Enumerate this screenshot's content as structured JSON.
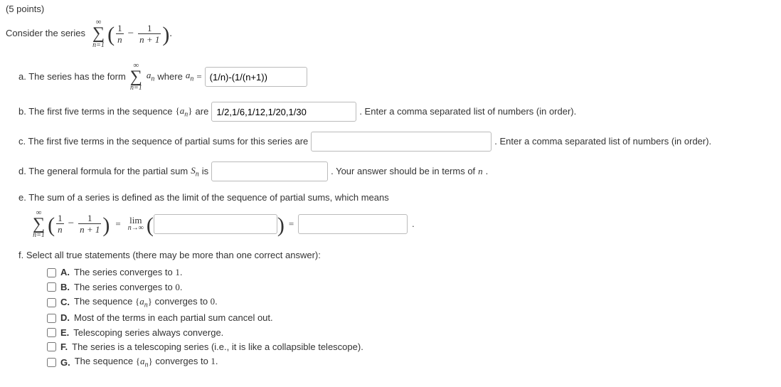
{
  "points": "(5 points)",
  "intro_label": "Consider the series",
  "sum_top": "∞",
  "sum_bottom": "n=1",
  "frac1_num": "1",
  "frac1_den": "n",
  "minus": "−",
  "frac2_num": "1",
  "frac2_den": "n + 1",
  "part_a": {
    "prefix": "a. The series has the form",
    "an_text": "aₙ",
    "where": " where ",
    "eq": " = ",
    "value": "(1/n)-(1/(n+1))"
  },
  "part_b": {
    "prefix": "b. The first five terms in the sequence ",
    "an_set": "{aₙ}",
    "are": " are ",
    "value": "1/2,1/6,1/12,1/20,1/30",
    "hint": " .  Enter a comma separated list of numbers (in order)."
  },
  "part_c": {
    "prefix": "c. The first five terms in the sequence of partial sums for this series are ",
    "value": "",
    "hint": " .  Enter a comma separated list of numbers (in order)."
  },
  "part_d": {
    "prefix": "d. The general formula for the partial sum ",
    "sn": "Sₙ",
    "is": " is ",
    "value": "",
    "hint": " .  Your answer should be in terms of ",
    "nvar": "n",
    "dot": "."
  },
  "part_e": {
    "prefix": "e. The sum of a series is defined as the limit of the sequence of partial sums, which means",
    "eq": " = ",
    "lim": "lim",
    "limsub": "n→∞",
    "val1": "",
    "val2": "",
    "dot": "."
  },
  "part_f": {
    "prefix": "f. Select all true statements (there may be more than one correct answer):",
    "choices": [
      {
        "letter": "A.",
        "text": "The series converges to ",
        "tail": "1",
        "taildot": "."
      },
      {
        "letter": "B.",
        "text": "The series converges to ",
        "tail": "0",
        "taildot": "."
      },
      {
        "letter": "C.",
        "text": "The sequence ",
        "mid": "{aₙ}",
        "text2": " converges to ",
        "tail": "0",
        "taildot": "."
      },
      {
        "letter": "D.",
        "text": "Most of the terms in each partial sum cancel out."
      },
      {
        "letter": "E.",
        "text": "Telescoping series always converge."
      },
      {
        "letter": "F.",
        "text": "The series is a telescoping series (i.e., it is like a collapsible telescope)."
      },
      {
        "letter": "G.",
        "text": "The sequence ",
        "mid": "{aₙ}",
        "text2": " converges to ",
        "tail": "1",
        "taildot": "."
      }
    ]
  }
}
